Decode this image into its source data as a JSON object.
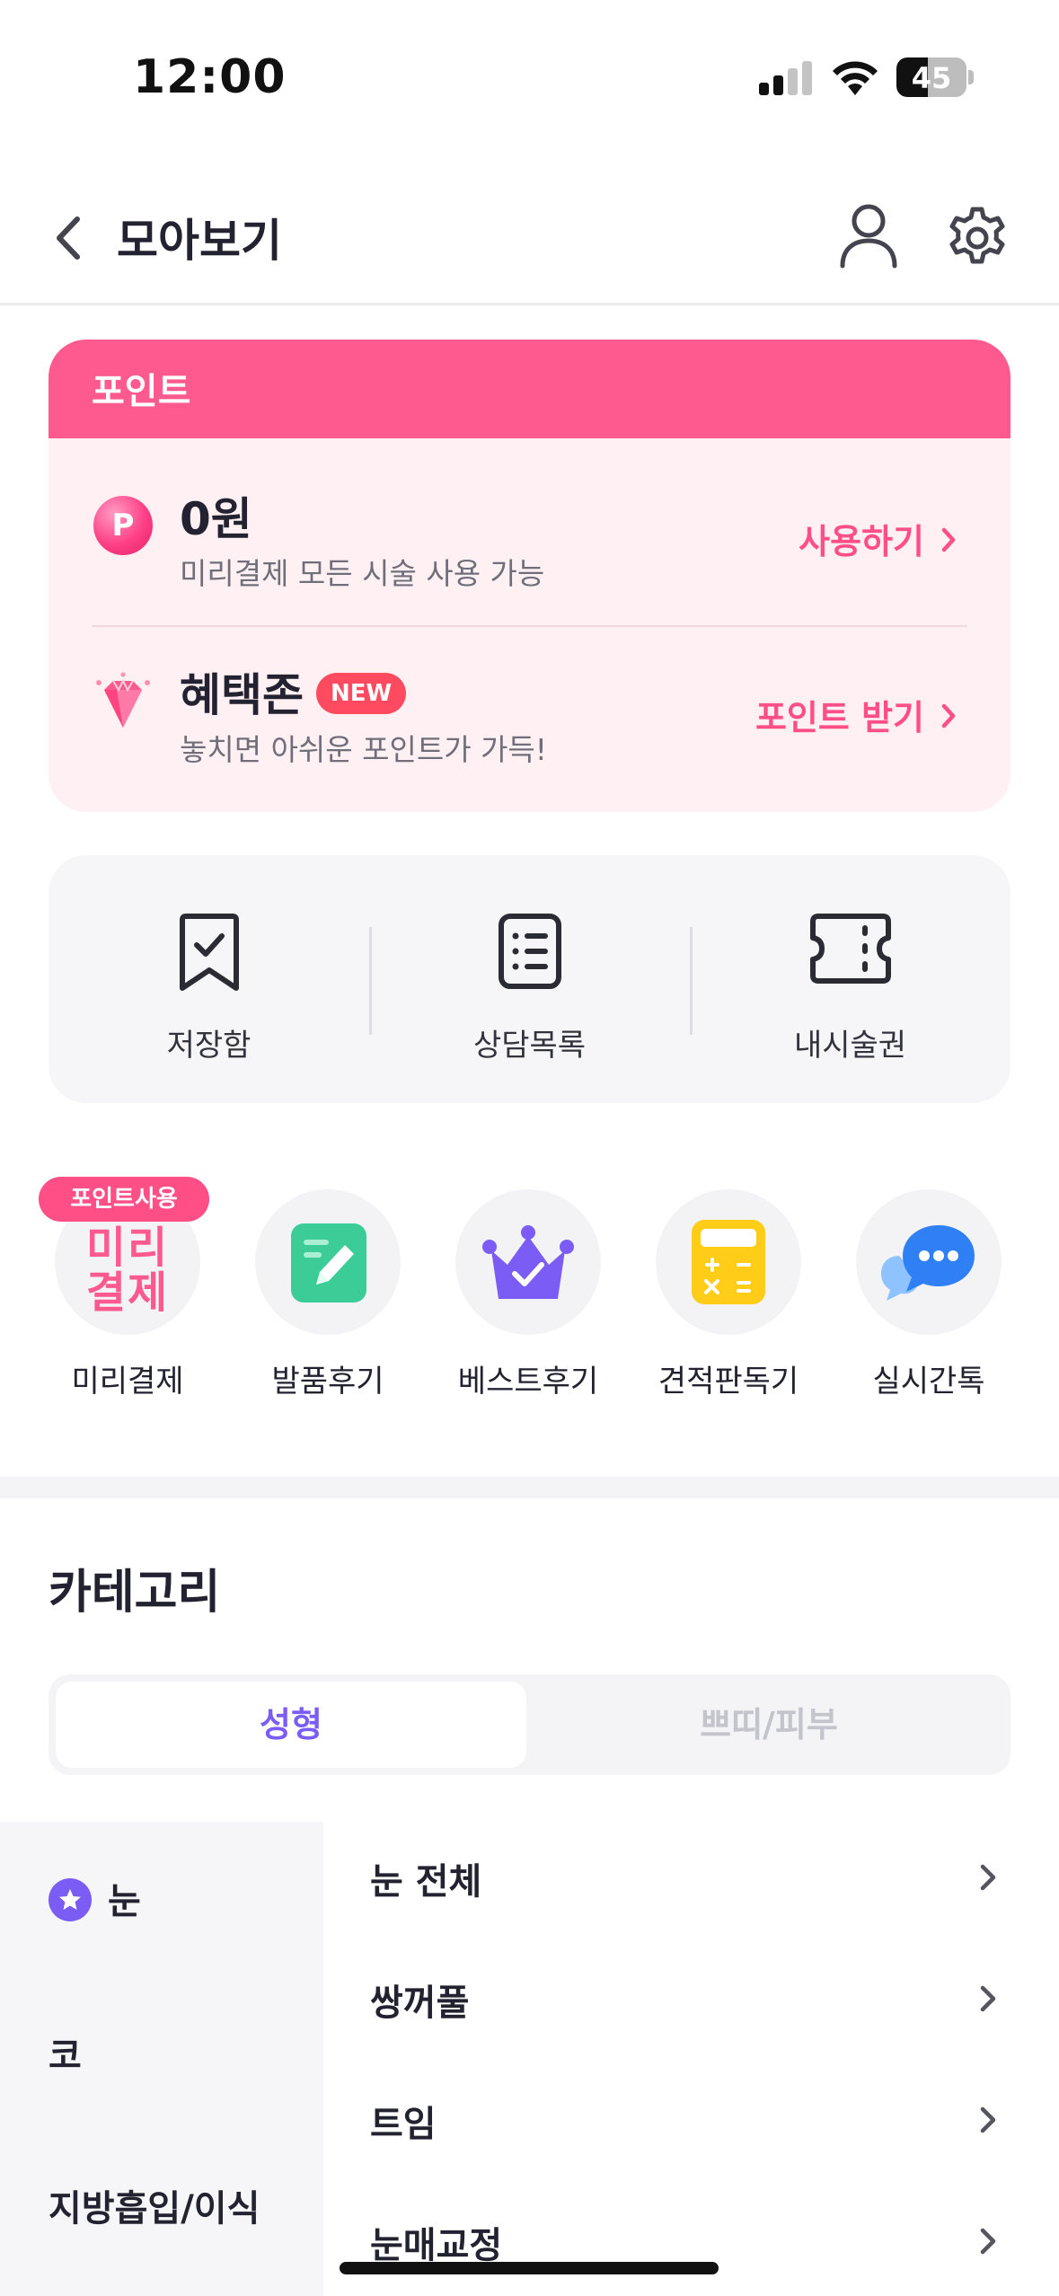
{
  "status_bar": {
    "time": "12:00",
    "battery": "45",
    "battery_level": 0.45
  },
  "header": {
    "title": "모아보기"
  },
  "point_card": {
    "title": "포인트",
    "rows": [
      {
        "title": "0원",
        "subtitle": "미리결제 모든 시술 사용 가능",
        "action": "사용하기",
        "icon": "p-coin-icon",
        "coin_letter": "P"
      },
      {
        "title": "혜택존",
        "badge": "NEW",
        "subtitle": "놓치면 아쉬운 포인트가 가득!",
        "action": "포인트 받기",
        "icon": "gem-icon"
      }
    ]
  },
  "quick_menu": [
    {
      "label": "저장함",
      "icon": "bookmark-icon"
    },
    {
      "label": "상담목록",
      "icon": "list-document-icon"
    },
    {
      "label": "내시술권",
      "icon": "ticket-icon"
    }
  ],
  "services": [
    {
      "label": "미리결제",
      "badge": "포인트사용",
      "icon_text_1": "미리",
      "icon_text_2": "결제"
    },
    {
      "label": "발품후기",
      "icon": "pencil-note-icon"
    },
    {
      "label": "베스트후기",
      "icon": "crown-icon"
    },
    {
      "label": "견적판독기",
      "icon": "calculator-icon"
    },
    {
      "label": "실시간톡",
      "icon": "chat-bubble-icon"
    }
  ],
  "category": {
    "title": "카테고리",
    "tabs": [
      "성형",
      "쁘띠/피부"
    ],
    "active_tab": "성형",
    "side_items": [
      "눈",
      "코",
      "지방흡입/이식"
    ],
    "active_side": "눈",
    "sub_items": [
      "눈 전체",
      "쌍꺼풀",
      "트임",
      "눈매교정"
    ]
  },
  "colors": {
    "accent_pink": "#ff5a8f",
    "accent_purple": "#7b5cf5"
  }
}
